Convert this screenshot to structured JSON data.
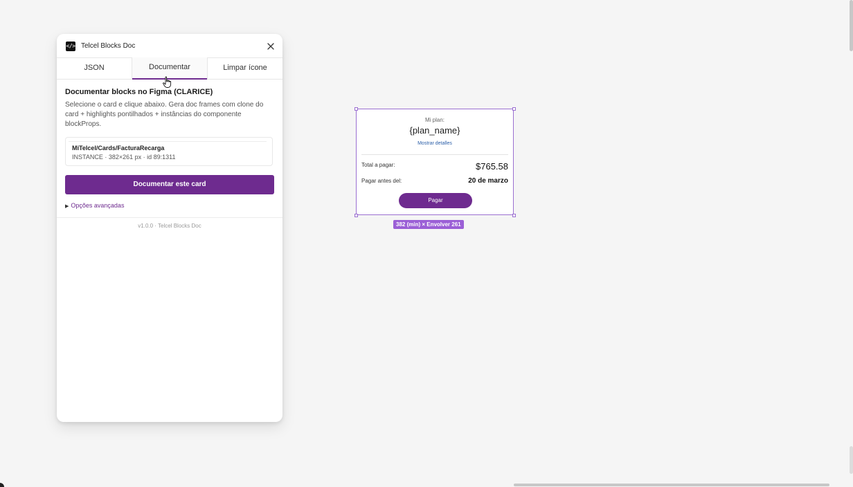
{
  "plugin": {
    "title": "Telcel Blocks Doc",
    "app_icon": "code-icon",
    "tabs": [
      {
        "label": "JSON",
        "active": false
      },
      {
        "label": "Documentar",
        "active": true
      },
      {
        "label": "Limpar ícone",
        "active": false
      }
    ],
    "section_title": "Documentar blocks no Figma (CLARICE)",
    "section_description": "Selecione o card e clique abaixo. Gera doc frames com clone do card + highlights pontilhados + instâncias do componente blockProps.",
    "selection": {
      "name": "MiTelcel/Cards/FacturaRecarga",
      "meta": "INSTANCE · 382×261 px · id 89:1311"
    },
    "primary_button": "Documentar este card",
    "advanced_options": "Opções avançadas",
    "version": "v1.0.0 · Telcel Blocks Doc"
  },
  "card": {
    "plan_label": "Mi plan:",
    "plan_name": "{plan_name}",
    "details_link": "Mostrar detalles",
    "total_label": "Total a pagar:",
    "total_value": "$765.58",
    "due_label": "Pagar antes del:",
    "due_value": "20 de marzo",
    "pay_button": "Pagar"
  },
  "size_badge": "382 (min) × Envolver  261",
  "colors": {
    "accent": "#6e2b8f",
    "selection": "#9b6fd1",
    "link": "#2a5ea8"
  }
}
